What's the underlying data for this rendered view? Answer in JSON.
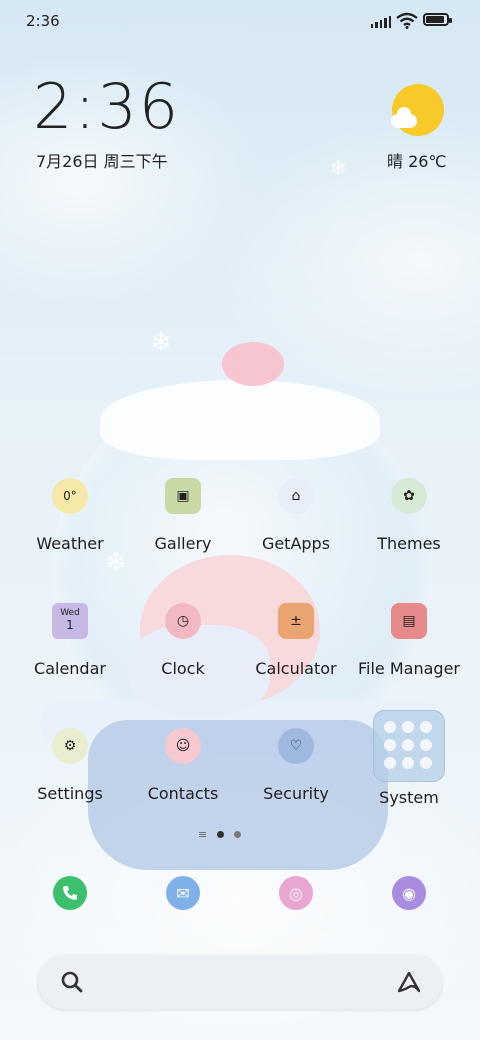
{
  "status_bar": {
    "time": "2:36",
    "battery_level": 0.9
  },
  "clock_widget": {
    "time": "2:36",
    "date": "7月26日 周三下午"
  },
  "weather_widget": {
    "text": "晴 26℃",
    "icon": "sun-cloud-icon"
  },
  "apps": [
    {
      "label": "Weather",
      "icon": "weather-icon",
      "badge": "0°",
      "color": "#f4e9a8"
    },
    {
      "label": "Gallery",
      "icon": "gallery-icon",
      "color": "#c8d9a4"
    },
    {
      "label": "GetApps",
      "icon": "getapps-icon",
      "color": "#e7eef8"
    },
    {
      "label": "Themes",
      "icon": "themes-icon",
      "color": "#d6ead5"
    },
    {
      "label": "Calendar",
      "icon": "calendar-icon",
      "badge": "Wed 1",
      "color": "#c7b8e6"
    },
    {
      "label": "Clock",
      "icon": "clock-icon",
      "color": "#f3b9c3"
    },
    {
      "label": "Calculator",
      "icon": "calculator-icon",
      "color": "#e9a472"
    },
    {
      "label": "File Manager",
      "icon": "file-manager-icon",
      "color": "#e88a8a"
    },
    {
      "label": "Settings",
      "icon": "settings-icon",
      "color": "#e8eecf"
    },
    {
      "label": "Contacts",
      "icon": "contacts-icon",
      "color": "#f6c8cf"
    },
    {
      "label": "Security",
      "icon": "security-icon",
      "color": "#9fb8df"
    },
    {
      "label": "System",
      "icon": "system-folder-icon",
      "color": "#b5cde6"
    }
  ],
  "page_indicator": {
    "pages": 2,
    "current": 1
  },
  "dock": [
    {
      "name": "phone",
      "icon": "phone-icon",
      "color": "#3cc06d"
    },
    {
      "name": "messages",
      "icon": "messages-icon",
      "color": "#7fb0e8"
    },
    {
      "name": "browser",
      "icon": "browser-icon",
      "color": "#e9a6d0"
    },
    {
      "name": "camera",
      "icon": "camera-icon",
      "color": "#a98be0"
    }
  ],
  "search_bar": {
    "search_icon": "search-icon",
    "assistant_icon": "assistant-icon"
  }
}
